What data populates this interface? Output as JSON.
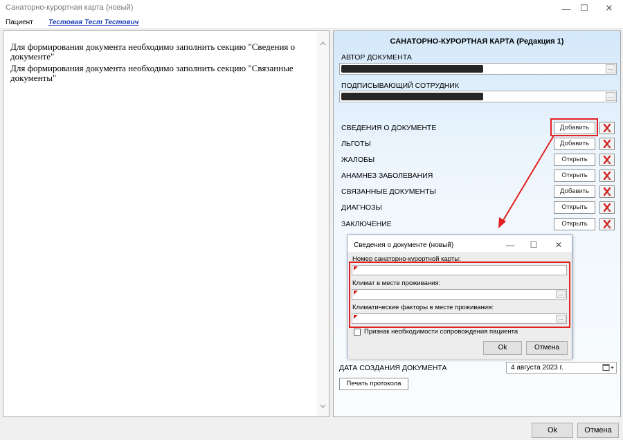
{
  "window": {
    "title": "Санаторно-курортная карта (новый)",
    "minimize_glyph": "—",
    "maximize_glyph": "☐",
    "close_glyph": "✕"
  },
  "patient": {
    "label": "Пациент",
    "name": "Тестовая Тест Тестович"
  },
  "messages": [
    "Для формирования документа необходимо заполнить секцию \"Сведения о документе\"",
    "Для формирования документа необходимо заполнить секцию \"Связанные документы\""
  ],
  "form": {
    "title": "САНАТОРНО-КУРОРТНАЯ КАРТА (Редакция 1)",
    "author_label": "АВТОР ДОКУМЕНТА",
    "signer_label": "ПОДПИСЫВАЮЩИЙ СОТРУДНИК",
    "ellipsis": "...",
    "sections": [
      {
        "label": "СВЕДЕНИЯ О ДОКУМЕНТЕ",
        "button": "Добавить"
      },
      {
        "label": "ЛЬГОТЫ",
        "button": "Добавить"
      },
      {
        "label": "ЖАЛОБЫ",
        "button": "Открыть"
      },
      {
        "label": "АНАМНЕЗ ЗАБОЛЕВАНИЯ",
        "button": "Открыть"
      },
      {
        "label": "СВЯЗАННЫЕ ДОКУМЕНТЫ",
        "button": "Добавить"
      },
      {
        "label": "ДИАГНОЗЫ",
        "button": "Открыть"
      },
      {
        "label": "ЗАКЛЮЧЕНИЕ",
        "button": "Открыть"
      }
    ],
    "date_label": "ДАТА СОЗДАНИЯ ДОКУМЕНТА",
    "date_value": "4  августа  2023 г.",
    "print_button": "Печать протокола"
  },
  "dialog": {
    "title": "Сведения о документе (новый)",
    "field1_label": "Номер санаторно-курортной карты:",
    "field2_label": "Климат в месте проживания:",
    "field3_label": "Климатические факторы в месте проживания:",
    "checkbox_label": "Признак необходимости сопровождения пациента",
    "ok": "Ok",
    "cancel": "Отмена"
  },
  "bottom": {
    "ok": "Ok",
    "cancel": "Отмена"
  },
  "colors": {
    "highlight": "#e22020",
    "link": "#1c3eb8"
  }
}
